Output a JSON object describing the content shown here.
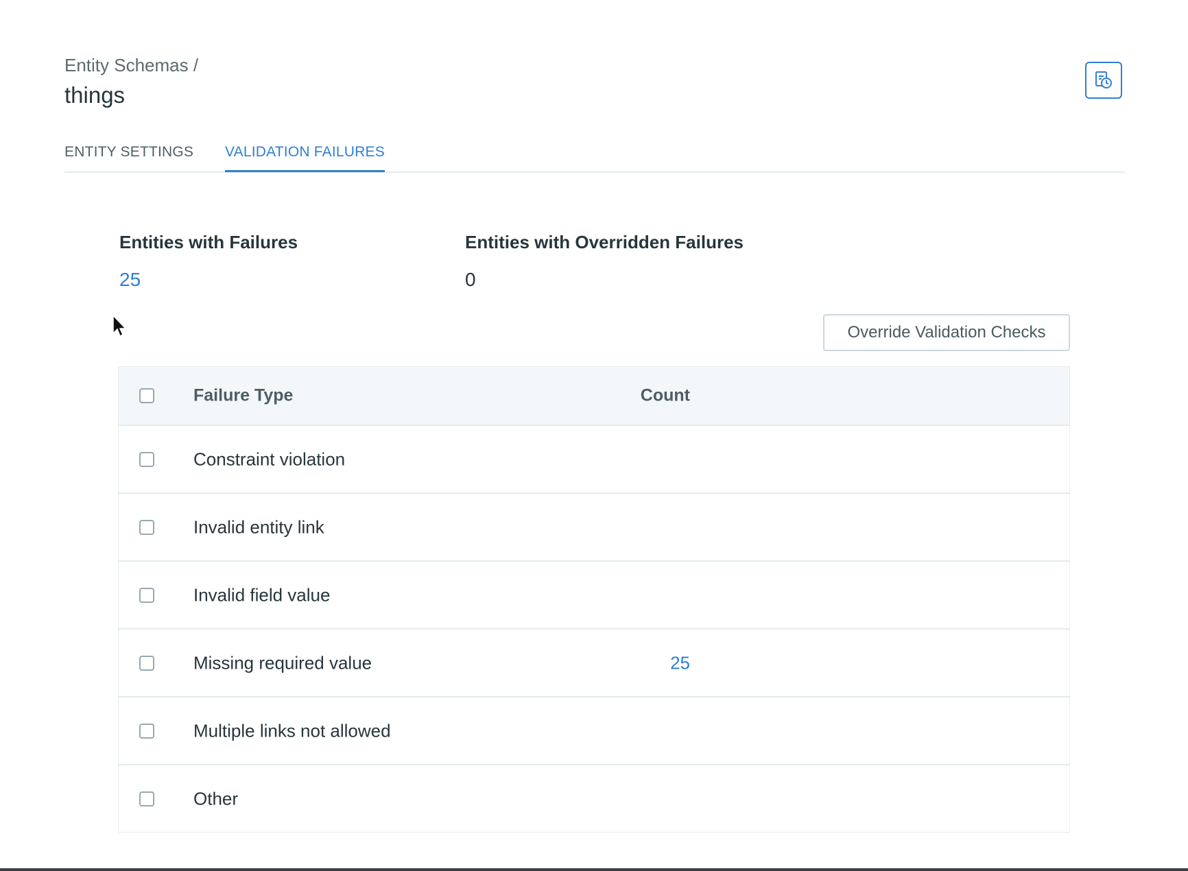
{
  "breadcrumb": "Entity Schemas /",
  "title": "things",
  "header": {
    "history_icon": "history-icon"
  },
  "tabs": [
    {
      "label": "ENTITY SETTINGS",
      "active": false
    },
    {
      "label": "VALIDATION FAILURES",
      "active": true
    }
  ],
  "stats": {
    "with_failures": {
      "label": "Entities with Failures",
      "value": "25"
    },
    "overridden": {
      "label": "Entities with Overridden Failures",
      "value": "0"
    }
  },
  "override_button": "Override Validation Checks",
  "table": {
    "headers": {
      "type": "Failure Type",
      "count": "Count"
    },
    "rows": [
      {
        "type": "Constraint violation",
        "count": ""
      },
      {
        "type": "Invalid entity link",
        "count": ""
      },
      {
        "type": "Invalid field value",
        "count": ""
      },
      {
        "type": "Missing required value",
        "count": "25"
      },
      {
        "type": "Multiple links not allowed",
        "count": ""
      },
      {
        "type": "Other",
        "count": ""
      }
    ]
  },
  "colors": {
    "accent": "#2f7fd4",
    "text": "#27363c",
    "header_bg": "#f4f7f9"
  }
}
